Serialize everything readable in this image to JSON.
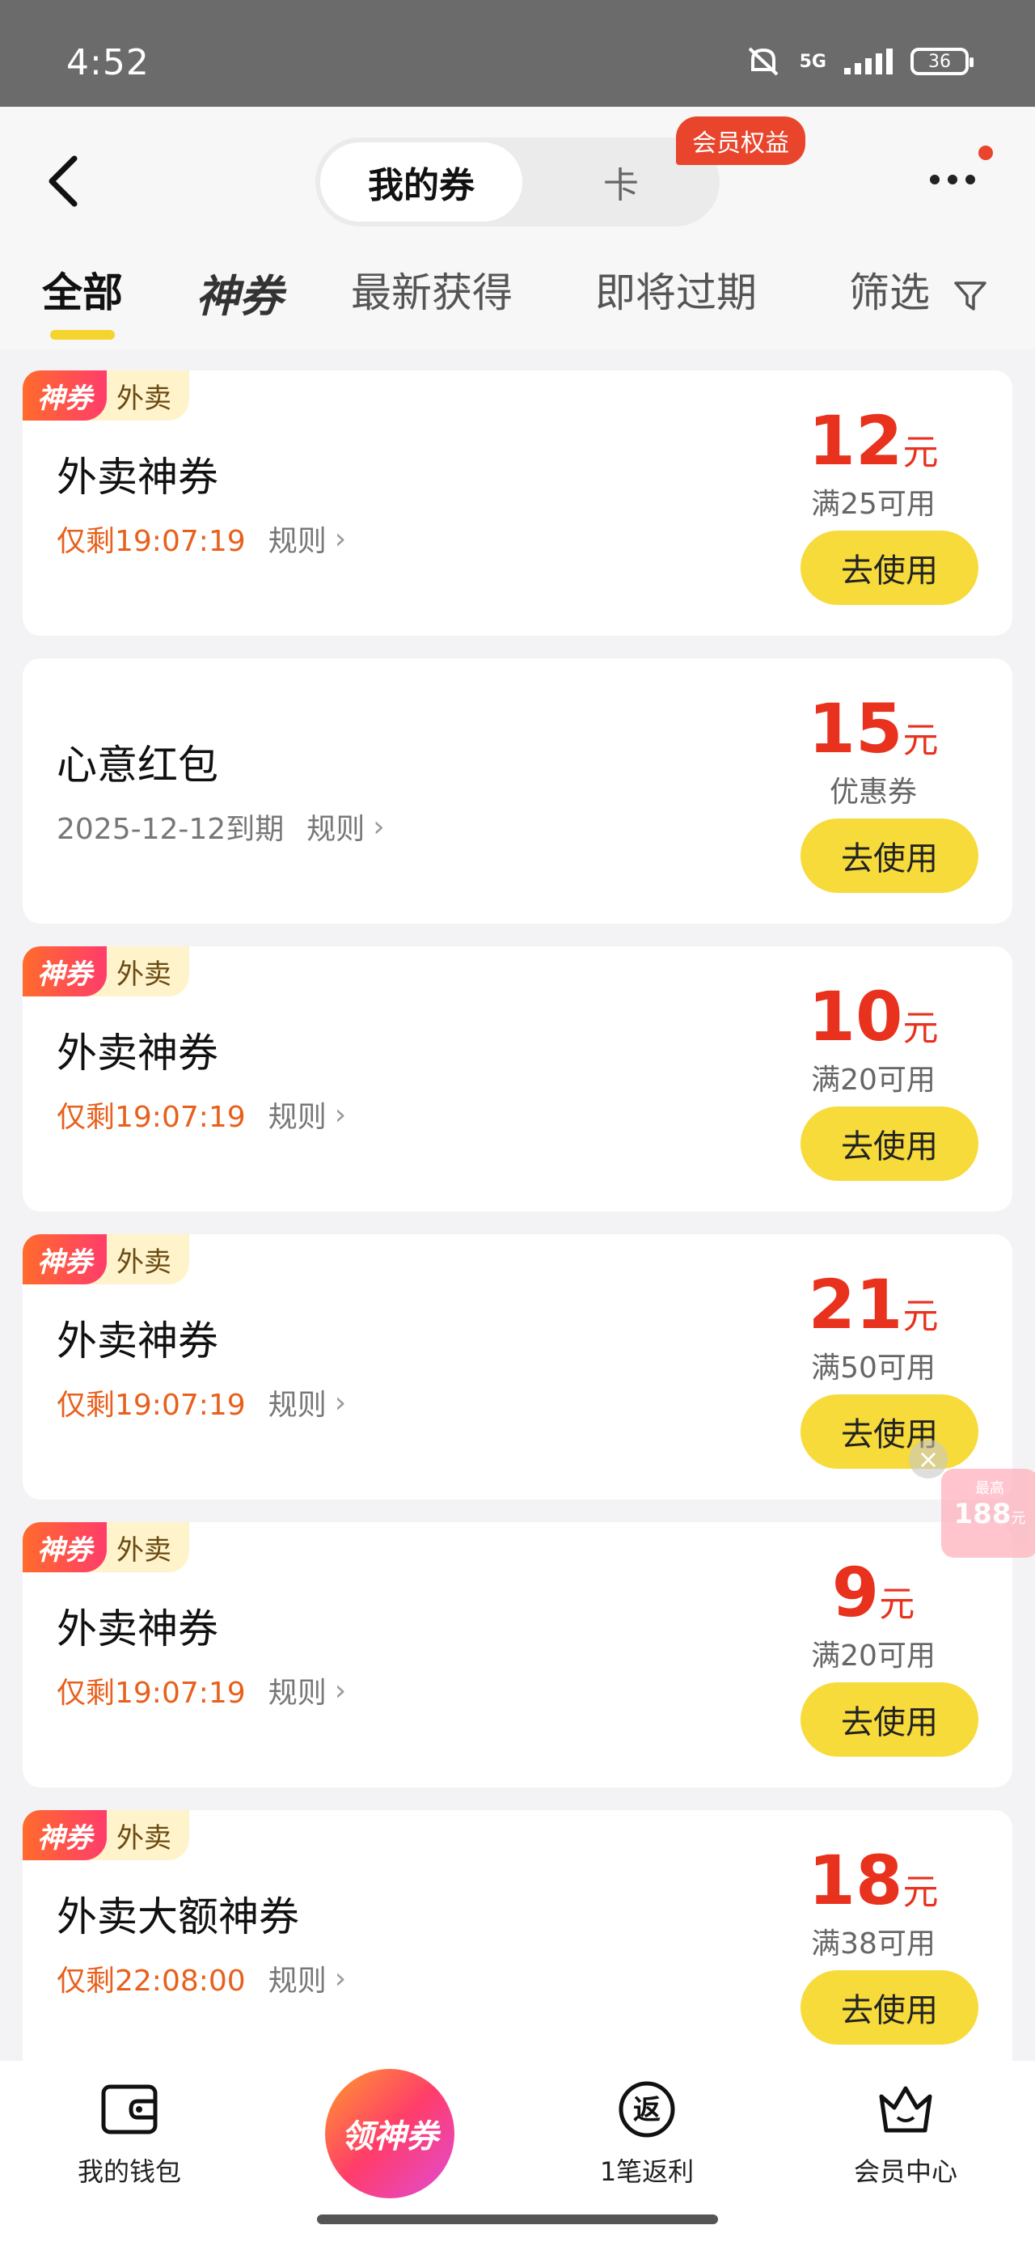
{
  "status": {
    "time": "4:52",
    "network": "5G",
    "battery": "36"
  },
  "header": {
    "segment_active": "我的券",
    "segment_other": "卡",
    "member_badge": "会员权益"
  },
  "tabs": [
    {
      "label": "全部",
      "active": true
    },
    {
      "label": "神券"
    },
    {
      "label": "最新获得"
    },
    {
      "label": "即将过期"
    },
    {
      "label": "筛选"
    }
  ],
  "coupons": [
    {
      "tag": "神券",
      "type": "外卖",
      "title": "外卖神券",
      "expiry": "仅剩19:07:19",
      "rule": "规则",
      "amount": "12",
      "unit": "元",
      "condition": "满25可用",
      "button": "去使用"
    },
    {
      "title": "心意红包",
      "expiry": "2025-12-12到期",
      "rule": "规则",
      "amount": "15",
      "unit": "元",
      "condition": "优惠券",
      "button": "去使用"
    },
    {
      "tag": "神券",
      "type": "外卖",
      "title": "外卖神券",
      "expiry": "仅剩19:07:19",
      "rule": "规则",
      "amount": "10",
      "unit": "元",
      "condition": "满20可用",
      "button": "去使用"
    },
    {
      "tag": "神券",
      "type": "外卖",
      "title": "外卖神券",
      "expiry": "仅剩19:07:19",
      "rule": "规则",
      "amount": "21",
      "unit": "元",
      "condition": "满50可用",
      "button": "去使用"
    },
    {
      "tag": "神券",
      "type": "外卖",
      "title": "外卖神券",
      "expiry": "仅剩19:07:19",
      "rule": "规则",
      "amount": "9",
      "unit": "元",
      "condition": "满20可用",
      "button": "去使用"
    },
    {
      "tag": "神券",
      "type": "外卖",
      "title": "外卖大额神券",
      "expiry": "仅剩22:08:00",
      "rule": "规则",
      "amount": "18",
      "unit": "元",
      "condition": "满38可用",
      "button": "去使用"
    }
  ],
  "float_widget": {
    "top_text": "最高",
    "amount": "188",
    "unit": "元"
  },
  "bottom_nav": {
    "wallet": "我的钱包",
    "center": "领神券",
    "rebate_icon": "返",
    "rebate": "1笔返利",
    "member": "会员中心"
  }
}
